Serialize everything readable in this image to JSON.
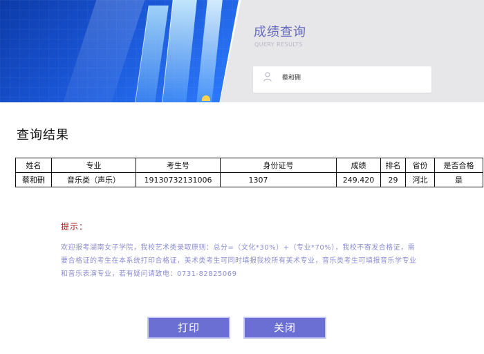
{
  "header": {
    "title": "成绩查询",
    "subtitle": "QUERY RESULTS",
    "user_name": "蔡和硎",
    "user_icon": "person-icon"
  },
  "result": {
    "title": "查询结果",
    "columns": [
      "姓名",
      "专业",
      "考生号",
      "身份证号",
      "成绩",
      "排名",
      "省份",
      "是否合格"
    ],
    "row": {
      "name": "蔡和硎",
      "major": "音乐类（声乐）",
      "exam_no": "19130732131006",
      "id_no": "1307",
      "score": "249.420",
      "rank": "29",
      "province": "河北",
      "qualified": "是"
    }
  },
  "tip": {
    "label": "提示：",
    "content": "欢迎报考湖南女子学院，我校艺术类录取原则：总分=（文化*30%）+（专业*70%），我校不寄发合格证，需要合格证的考生在本系统打印合格证，美术类考生可同时填报我校所有美术专业，音乐类考生可填报音乐学专业和音乐表演专业，若有疑问请致电：0731-82825069"
  },
  "buttons": {
    "print": "打印",
    "close": "关闭"
  },
  "colors": {
    "accent": "#6b6fd3",
    "tip_label": "#a12121",
    "tip_text": "#8c8fd0",
    "header_title": "#6469b8"
  }
}
